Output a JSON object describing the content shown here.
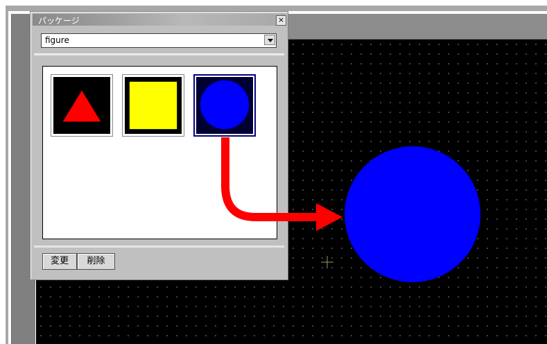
{
  "palette": {
    "title": "パッケージ",
    "close_glyph": "×",
    "category_select": {
      "value": "figure"
    },
    "items": [
      {
        "name": "triangle",
        "color": "#ff0000",
        "selected": false
      },
      {
        "name": "square",
        "color": "#ffff00",
        "selected": false
      },
      {
        "name": "circle",
        "color": "#0000ff",
        "selected": true
      }
    ],
    "buttons": {
      "change_label": "変更",
      "delete_label": "削除"
    }
  },
  "canvas": {
    "background": "#000000",
    "placed_object": {
      "shape": "circle",
      "color": "#0000ff"
    }
  },
  "drag_arrow": {
    "color": "#ff0000"
  }
}
